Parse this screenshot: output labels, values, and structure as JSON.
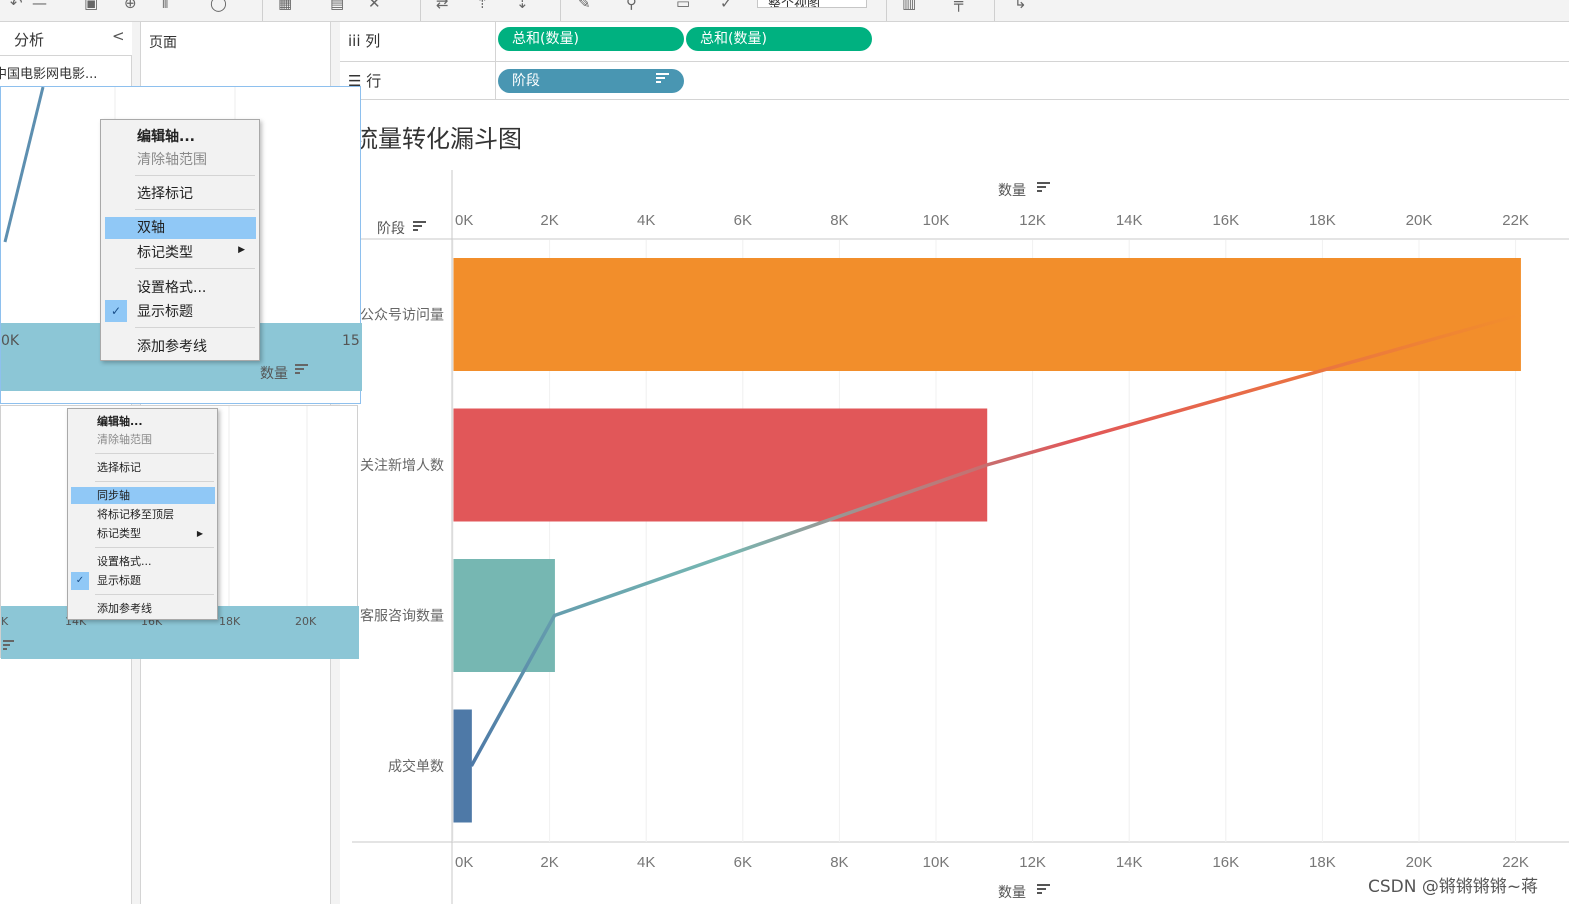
{
  "left_panel": {
    "analysis_title": "分析",
    "collapse_glyph": "<",
    "data_source_item": "中国电影网电影..."
  },
  "pages_panel": {
    "title": "页面"
  },
  "toolbar": {
    "view_dropdown": "整个视图"
  },
  "shelves": {
    "columns": {
      "icon": "iii",
      "label": "列",
      "pills": [
        "总和(数量)",
        "总和(数量)"
      ]
    },
    "rows": {
      "icon": "☰",
      "label": "行",
      "pills": [
        "阶段"
      ]
    }
  },
  "sort_icon": "sort-descending-icon",
  "chart": {
    "title": "流量转化漏斗图",
    "x_axis_title": "数量",
    "row_header": "阶段"
  },
  "chart_data": {
    "type": "bar",
    "title": "流量转化漏斗图",
    "categories": [
      "公众号访问量",
      "关注新增人数",
      "客服咨询数量",
      "成交单数"
    ],
    "values": [
      22100,
      11050,
      2100,
      380
    ],
    "colors": [
      "#f28e2b",
      "#e15759",
      "#76b7b2",
      "#4e79a7"
    ],
    "line_overlay": {
      "type": "line",
      "values": [
        22100,
        11050,
        2100,
        380
      ]
    },
    "xlabel": "数量",
    "ylabel": "阶段",
    "xlim": [
      0,
      23000
    ],
    "xticks": [
      "0K",
      "2K",
      "4K",
      "6K",
      "8K",
      "10K",
      "12K",
      "14K",
      "16K",
      "18K",
      "20K",
      "22K"
    ],
    "axes": [
      "top",
      "bottom"
    ],
    "grid": true
  },
  "thumb1": {
    "axis_ticks": [
      "0K",
      "15"
    ],
    "axis_title": "数量"
  },
  "thumb2": {
    "axis_ticks": [
      "K",
      "14K",
      "16K",
      "18K",
      "20K"
    ]
  },
  "menu1": {
    "items": [
      "编辑轴...",
      "清除轴范围",
      "选择标记",
      "双轴",
      "标记类型",
      "设置格式...",
      "显示标题",
      "添加参考线"
    ]
  },
  "menu2": {
    "items": [
      "编辑轴...",
      "清除轴范围",
      "选择标记",
      "同步轴",
      "将标记移至顶层",
      "标记类型",
      "设置格式...",
      "显示标题",
      "添加参考线"
    ]
  },
  "watermark": "CSDN @锵锵锵锵~蒋"
}
